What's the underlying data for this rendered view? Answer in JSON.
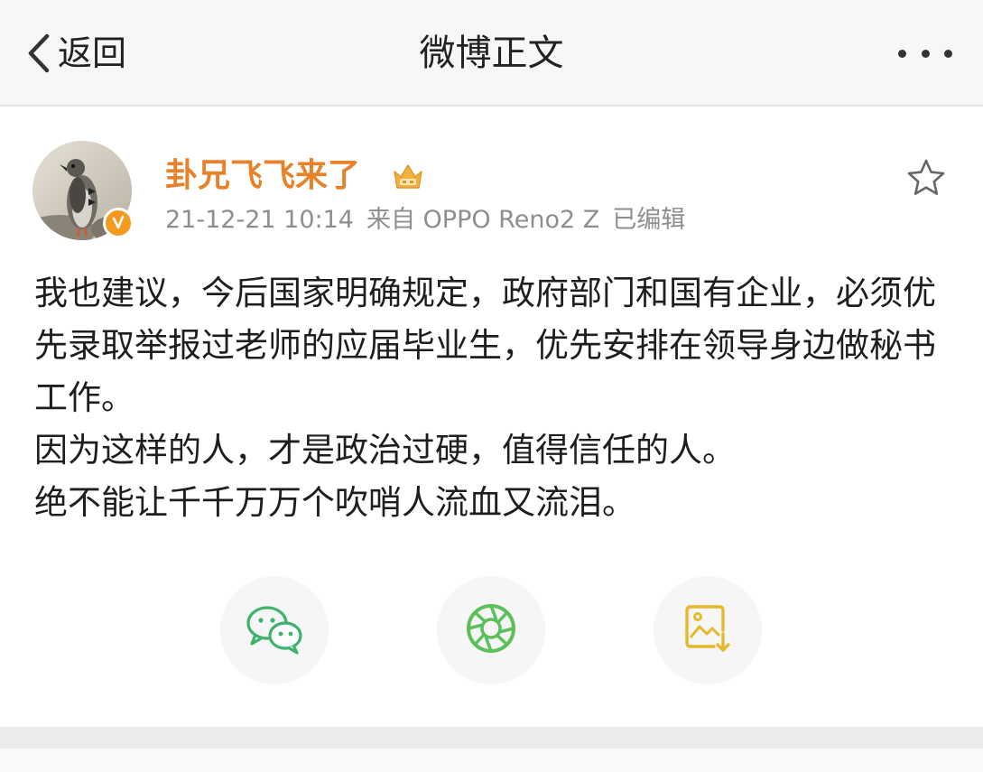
{
  "navbar": {
    "back_label": "返回",
    "title": "微博正文",
    "more_icon": "more-dots-icon"
  },
  "post": {
    "username": "卦兄飞飞来了",
    "member_badge_icon": "vip-crown-icon",
    "verified_icon": "verified-v-icon",
    "time": "21-12-21 10:14",
    "source": "来自 OPPO Reno2 Z",
    "edited": "已编辑",
    "favorite_icon": "star-icon",
    "body_lines": [
      "我也建议，今后国家明确规定，政府部门和国有企业，必须优先录取举报过老师的应届毕业生，优先安排在领导身边做秘书工作。",
      "因为这样的人，才是政治过硬，值得信任的人。",
      "绝不能让千千万万个吹哨人流血又流泪。"
    ]
  },
  "share": {
    "items": [
      {
        "icon": "wechat-icon",
        "color": "#3fb36b"
      },
      {
        "icon": "moments-icon",
        "color": "#5cc05a"
      },
      {
        "icon": "save-image-icon",
        "color": "#e6b92c"
      }
    ]
  },
  "colors": {
    "username": "#e8822a",
    "meta": "#8e8e8e",
    "navbar_bg": "#f7f7f7"
  }
}
